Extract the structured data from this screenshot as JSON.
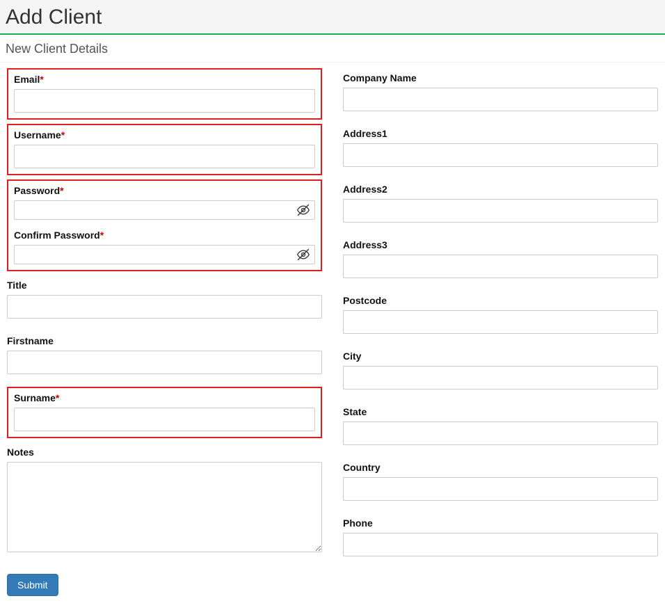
{
  "header": {
    "title": "Add Client"
  },
  "section": {
    "title": "New Client Details"
  },
  "left": {
    "email": {
      "label": "Email",
      "required": true,
      "value": ""
    },
    "username": {
      "label": "Username",
      "required": true,
      "value": ""
    },
    "password": {
      "label": "Password",
      "required": true,
      "value": ""
    },
    "confirm_password": {
      "label": "Confirm Password",
      "required": true,
      "value": ""
    },
    "title": {
      "label": "Title",
      "required": false,
      "value": ""
    },
    "firstname": {
      "label": "Firstname",
      "required": false,
      "value": ""
    },
    "surname": {
      "label": "Surname",
      "required": true,
      "value": ""
    },
    "notes": {
      "label": "Notes",
      "required": false,
      "value": ""
    }
  },
  "right": {
    "company_name": {
      "label": "Company Name",
      "value": ""
    },
    "address1": {
      "label": "Address1",
      "value": ""
    },
    "address2": {
      "label": "Address2",
      "value": ""
    },
    "address3": {
      "label": "Address3",
      "value": ""
    },
    "postcode": {
      "label": "Postcode",
      "value": ""
    },
    "city": {
      "label": "City",
      "value": ""
    },
    "state": {
      "label": "State",
      "value": ""
    },
    "country": {
      "label": "Country",
      "value": ""
    },
    "phone": {
      "label": "Phone",
      "value": ""
    }
  },
  "actions": {
    "submit": "Submit"
  }
}
